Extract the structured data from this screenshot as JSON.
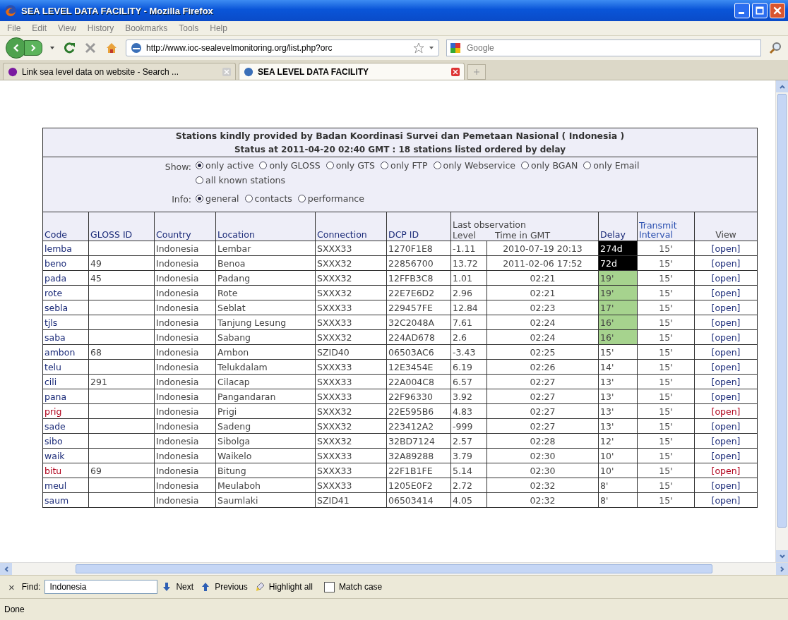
{
  "window": {
    "title": "SEA LEVEL DATA FACILITY - Mozilla Firefox"
  },
  "menu": [
    "File",
    "Edit",
    "View",
    "History",
    "Bookmarks",
    "Tools",
    "Help"
  ],
  "toolbar": {
    "url": "http://www.ioc-sealevelmonitoring.org/list.php?orc",
    "search_placeholder": "Google"
  },
  "tabs": [
    {
      "label": "Link sea level data on website - Search ...",
      "selected": false
    },
    {
      "label": "SEA LEVEL DATA FACILITY",
      "selected": true
    }
  ],
  "page": {
    "title": "Stations kindly provided by Badan Koordinasi Survei dan Pemetaan Nasional ( Indonesia )",
    "status": "Status at 2011-04-20 02:40 GMT : 18 stations listed ordered by delay",
    "show": {
      "label": "Show:",
      "options": [
        {
          "label": "only active",
          "selected": true
        },
        {
          "label": "only GLOSS",
          "selected": false
        },
        {
          "label": "only GTS",
          "selected": false
        },
        {
          "label": "only FTP",
          "selected": false
        },
        {
          "label": "only Webservice",
          "selected": false
        },
        {
          "label": "only BGAN",
          "selected": false
        },
        {
          "label": "only Email",
          "selected": false
        },
        {
          "label": "all known stations",
          "selected": false
        }
      ]
    },
    "info": {
      "label": "Info:",
      "options": [
        {
          "label": "general",
          "selected": true
        },
        {
          "label": "contacts",
          "selected": false
        },
        {
          "label": "performance",
          "selected": false
        }
      ]
    }
  },
  "table": {
    "columns": [
      {
        "label": "Code",
        "link": false
      },
      {
        "label": "GLOSS ID",
        "link": false
      },
      {
        "label": "Country",
        "link": false
      },
      {
        "label": "Location",
        "link": false
      },
      {
        "label": "Connection",
        "link": false
      },
      {
        "label": "DCP ID",
        "link": false
      }
    ],
    "observation": {
      "label": "Last observation",
      "columns": [
        "Level",
        "Time in GMT"
      ]
    },
    "columns_after": [
      {
        "label": "Delay",
        "link": false
      },
      {
        "label": "Transmit Interval",
        "link": true
      },
      {
        "label": "View",
        "link": false
      }
    ],
    "rows": [
      {
        "code": "lemba",
        "gloss": "",
        "country": "Indonesia",
        "location": "Lembar",
        "connection": "SXXX33",
        "dcp": "1270F1E8",
        "level": "-1.11",
        "time": "2010-07-19 20:13",
        "delay": {
          "text": "274d",
          "kind": "stale"
        },
        "interval": "15'",
        "view": "[open]",
        "flagged": false
      },
      {
        "code": "beno",
        "gloss": "49",
        "country": "Indonesia",
        "location": "Benoa",
        "connection": "SXXX32",
        "dcp": "22856700",
        "level": "13.72",
        "time": "2011-02-06 17:52",
        "delay": {
          "text": "72d",
          "kind": "stale"
        },
        "interval": "15'",
        "view": "[open]",
        "flagged": false
      },
      {
        "code": "pada",
        "gloss": "45",
        "country": "Indonesia",
        "location": "Padang",
        "connection": "SXXX32",
        "dcp": "12FFB3C8",
        "level": "1.01",
        "time": "02:21",
        "delay": {
          "text": "19'",
          "kind": "late"
        },
        "interval": "15'",
        "view": "[open]",
        "flagged": false
      },
      {
        "code": "rote",
        "gloss": "",
        "country": "Indonesia",
        "location": "Rote",
        "connection": "SXXX32",
        "dcp": "22E7E6D2",
        "level": "2.96",
        "time": "02:21",
        "delay": {
          "text": "19'",
          "kind": "late"
        },
        "interval": "15'",
        "view": "[open]",
        "flagged": false
      },
      {
        "code": "sebla",
        "gloss": "",
        "country": "Indonesia",
        "location": "Seblat",
        "connection": "SXXX33",
        "dcp": "229457FE",
        "level": "12.84",
        "time": "02:23",
        "delay": {
          "text": "17'",
          "kind": "late"
        },
        "interval": "15'",
        "view": "[open]",
        "flagged": false
      },
      {
        "code": "tjls",
        "gloss": "",
        "country": "Indonesia",
        "location": "Tanjung Lesung",
        "connection": "SXXX33",
        "dcp": "32C2048A",
        "level": "7.61",
        "time": "02:24",
        "delay": {
          "text": "16'",
          "kind": "late"
        },
        "interval": "15'",
        "view": "[open]",
        "flagged": false
      },
      {
        "code": "saba",
        "gloss": "",
        "country": "Indonesia",
        "location": "Sabang",
        "connection": "SXXX32",
        "dcp": "224AD678",
        "level": "2.6",
        "time": "02:24",
        "delay": {
          "text": "16'",
          "kind": "late"
        },
        "interval": "15'",
        "view": "[open]",
        "flagged": false
      },
      {
        "code": "ambon",
        "gloss": "68",
        "country": "Indonesia",
        "location": "Ambon",
        "connection": "SZID40",
        "dcp": "06503AC6",
        "level": "-3.43",
        "time": "02:25",
        "delay": {
          "text": "15'",
          "kind": "normal"
        },
        "interval": "15'",
        "view": "[open]",
        "flagged": false
      },
      {
        "code": "telu",
        "gloss": "",
        "country": "Indonesia",
        "location": "Telukdalam",
        "connection": "SXXX33",
        "dcp": "12E3454E",
        "level": "6.19",
        "time": "02:26",
        "delay": {
          "text": "14'",
          "kind": "normal"
        },
        "interval": "15'",
        "view": "[open]",
        "flagged": false
      },
      {
        "code": "cili",
        "gloss": "291",
        "country": "Indonesia",
        "location": "Cilacap",
        "connection": "SXXX33",
        "dcp": "22A004C8",
        "level": "6.57",
        "time": "02:27",
        "delay": {
          "text": "13'",
          "kind": "normal"
        },
        "interval": "15'",
        "view": "[open]",
        "flagged": false
      },
      {
        "code": "pana",
        "gloss": "",
        "country": "Indonesia",
        "location": "Pangandaran",
        "connection": "SXXX33",
        "dcp": "22F96330",
        "level": "3.92",
        "time": "02:27",
        "delay": {
          "text": "13'",
          "kind": "normal"
        },
        "interval": "15'",
        "view": "[open]",
        "flagged": false
      },
      {
        "code": "prig",
        "gloss": "",
        "country": "Indonesia",
        "location": "Prigi",
        "connection": "SXXX32",
        "dcp": "22E595B6",
        "level": "4.83",
        "time": "02:27",
        "delay": {
          "text": "13'",
          "kind": "normal"
        },
        "interval": "15'",
        "view": "[open]",
        "flagged": true
      },
      {
        "code": "sade",
        "gloss": "",
        "country": "Indonesia",
        "location": "Sadeng",
        "connection": "SXXX32",
        "dcp": "223412A2",
        "level": "-999",
        "time": "02:27",
        "delay": {
          "text": "13'",
          "kind": "normal"
        },
        "interval": "15'",
        "view": "[open]",
        "flagged": false
      },
      {
        "code": "sibo",
        "gloss": "",
        "country": "Indonesia",
        "location": "Sibolga",
        "connection": "SXXX32",
        "dcp": "32BD7124",
        "level": "2.57",
        "time": "02:28",
        "delay": {
          "text": "12'",
          "kind": "normal"
        },
        "interval": "15'",
        "view": "[open]",
        "flagged": false
      },
      {
        "code": "waik",
        "gloss": "",
        "country": "Indonesia",
        "location": "Waikelo",
        "connection": "SXXX33",
        "dcp": "32A89288",
        "level": "3.79",
        "time": "02:30",
        "delay": {
          "text": "10'",
          "kind": "normal"
        },
        "interval": "15'",
        "view": "[open]",
        "flagged": false
      },
      {
        "code": "bitu",
        "gloss": "69",
        "country": "Indonesia",
        "location": "Bitung",
        "connection": "SXXX33",
        "dcp": "22F1B1FE",
        "level": "5.14",
        "time": "02:30",
        "delay": {
          "text": "10'",
          "kind": "normal"
        },
        "interval": "15'",
        "view": "[open]",
        "flagged": true
      },
      {
        "code": "meul",
        "gloss": "",
        "country": "Indonesia",
        "location": "Meulaboh",
        "connection": "SXXX33",
        "dcp": "1205E0F2",
        "level": "2.72",
        "time": "02:32",
        "delay": {
          "text": "8'",
          "kind": "normal"
        },
        "interval": "15'",
        "view": "[open]",
        "flagged": false
      },
      {
        "code": "saum",
        "gloss": "",
        "country": "Indonesia",
        "location": "Saumlaki",
        "connection": "SZID41",
        "dcp": "06503414",
        "level": "4.05",
        "time": "02:32",
        "delay": {
          "text": "8'",
          "kind": "normal"
        },
        "interval": "15'",
        "view": "[open]",
        "flagged": false
      }
    ]
  },
  "find_bar": {
    "close": "×",
    "label": "Find:",
    "value": "Indonesia",
    "next": "Next",
    "previous": "Previous",
    "highlight": "Highlight all",
    "match_case": {
      "label": "Match case",
      "checked": false
    }
  },
  "status_bar": "Done"
}
